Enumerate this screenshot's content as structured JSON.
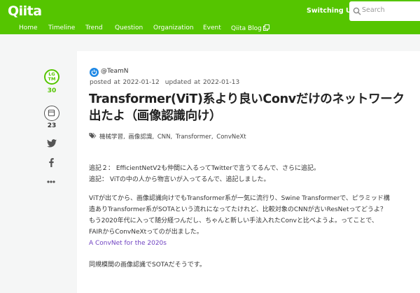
{
  "header": {
    "logo": "Qiita",
    "switching_ui": "Switching UI",
    "search_placeholder": "Search"
  },
  "nav": {
    "items": [
      "Home",
      "Timeline",
      "Trend",
      "Question",
      "Organization",
      "Event",
      "Qiita Blog"
    ]
  },
  "side": {
    "lgtm_label": "LG\nTM",
    "lgtm_count": "30",
    "stock_count": "23"
  },
  "article": {
    "org": "@TeamN",
    "posted": "posted at 2022-01-12",
    "updated": "updated at 2022-01-13",
    "title": "Transformer(ViT)系より良いConvだけのネットワーク出たよ（画像認識向け）",
    "tags": [
      "機械学習,",
      "画像認識,",
      "CNN,",
      "Transformer,",
      "ConvNeXt"
    ],
    "para1_line1": "追記２： EfficientNetV2も仲間に入るってTwitterで言うてるんで、さらに追記。",
    "para1_line2": "追記： ViTの中の人から物言いが入ってるんで、追記しました。",
    "para2_line1": "ViTが出てから、画像認識向けでもTransformer系が一気に流行り、Swine Transformerで、ピラミッド構",
    "para2_line2": "造ありTransformer系がSOTAという流れになってたけれど、比較対象のCNNが古いResNetってどうよ？",
    "para2_line3": "もう2020年代に入って随分経つんだし、ちゃんと新しい手法入れたConvと比べようよ。ってことで、",
    "para2_line4": "FAIRからConvNeXtってのが出ました。",
    "link": "A ConvNet for the 2020s",
    "para3": "同規模間の画像認識でSOTAだそうです。"
  },
  "colors": {
    "brand": "#55c500",
    "link": "#6f42c1"
  }
}
